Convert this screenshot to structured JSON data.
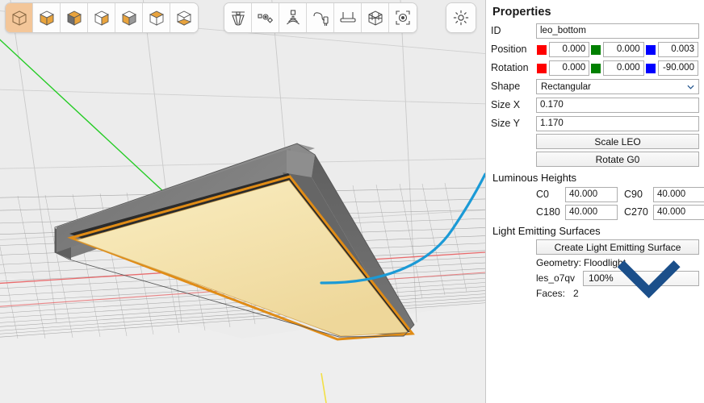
{
  "toolbar": {
    "cube_views": [
      {
        "name": "view-iso-wireframe",
        "label": "Isometric wireframe view",
        "selected": true
      },
      {
        "name": "view-top-front",
        "label": "Top and front highlighted",
        "selected": false
      },
      {
        "name": "view-top",
        "label": "Top face highlighted",
        "selected": false
      },
      {
        "name": "view-right",
        "label": "Right face highlighted",
        "selected": false
      },
      {
        "name": "view-front",
        "label": "Front face highlighted",
        "selected": false
      },
      {
        "name": "view-top-alt",
        "label": "Top face alternate",
        "selected": false
      },
      {
        "name": "view-bottom",
        "label": "Bottom face highlighted",
        "selected": false
      }
    ],
    "tools": [
      {
        "name": "luminaire-icon",
        "label": "Luminaire"
      },
      {
        "name": "sensor-icon",
        "label": "Sensors"
      },
      {
        "name": "wireless-icon",
        "label": "Wireless node"
      },
      {
        "name": "power-plug-icon",
        "label": "Power supply"
      },
      {
        "name": "mounting-rail-icon",
        "label": "Mounting"
      },
      {
        "name": "bounding-box-icon",
        "label": "Bounding box"
      },
      {
        "name": "photometric-center-icon",
        "label": "Photometric center"
      }
    ],
    "settings": {
      "name": "gear-icon",
      "label": "Settings"
    }
  },
  "panel": {
    "title": "Properties",
    "id": {
      "label": "ID",
      "value": "leo_bottom"
    },
    "position": {
      "label": "Position",
      "x": "0.000",
      "y": "0.000",
      "z": "0.003"
    },
    "rotation": {
      "label": "Rotation",
      "x": "0.000",
      "y": "0.000",
      "z": "-90.000"
    },
    "shape": {
      "label": "Shape",
      "value": "Rectangular"
    },
    "size_x": {
      "label": "Size X",
      "value": "0.170"
    },
    "size_y": {
      "label": "Size Y",
      "value": "1.170"
    },
    "scale_button": "Scale LEO",
    "rotate_button": "Rotate G0",
    "luminous_heights": {
      "title": "Luminous Heights",
      "c0": {
        "label": "C0",
        "value": "40.000"
      },
      "c90": {
        "label": "C90",
        "value": "40.000"
      },
      "c180": {
        "label": "C180",
        "value": "40.000"
      },
      "c270": {
        "label": "C270",
        "value": "40.000"
      }
    },
    "light_emitting_surfaces": {
      "title": "Light Emitting Surfaces",
      "create_button": "Create Light Emitting Surface",
      "geometry_label": "Geometry:",
      "geometry_value": "Floodlight",
      "les_id": "les_o7qv",
      "les_percent": "100%",
      "faces_label": "Faces:",
      "faces_value": "2"
    }
  },
  "colors": {
    "accent_selected": "#f3c699",
    "axis_red": "#e8696b",
    "axis_green": "#26cc26",
    "axis_yellow": "#f2e045",
    "annotation_blue": "#1b9ad6",
    "emitter_fill": "#f6e2a8",
    "emitter_edge": "#e08c16",
    "housing_top": "#8c8c8c",
    "housing_side": "#6d6d6d",
    "viewport_bg": "#eeeeee",
    "swatch_x": "#ff0000",
    "swatch_y": "#008000",
    "swatch_z": "#0000ff"
  },
  "viewport": {
    "name": "3d-viewport",
    "scene": "ceiling-mounted rectangular luminaire with luminous emitting surface",
    "annotation_arrow": "curved blue arrow from luminaire bottom to C0 luminous height field"
  }
}
